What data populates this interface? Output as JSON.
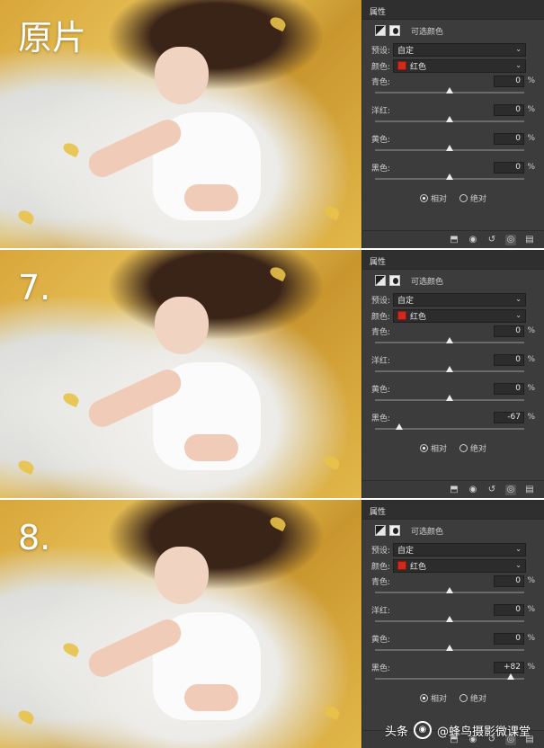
{
  "panels": [
    {
      "label": "原片",
      "title": "属性",
      "layer_name": "可选颜色",
      "preset_label": "预设:",
      "preset_value": "自定",
      "color_label": "颜色:",
      "color_value": "红色",
      "sliders": [
        {
          "name": "青色:",
          "value": "0",
          "unit": "%",
          "level": 0
        },
        {
          "name": "洋红:",
          "value": "0",
          "unit": "%",
          "level": 0
        },
        {
          "name": "黄色:",
          "value": "0",
          "unit": "%",
          "level": 0
        },
        {
          "name": "黑色:",
          "value": "0",
          "unit": "%",
          "level": 0
        }
      ],
      "relative_label": "相对",
      "absolute_label": "绝对"
    },
    {
      "label": "7.",
      "title": "属性",
      "layer_name": "可选颜色",
      "preset_label": "预设:",
      "preset_value": "自定",
      "color_label": "颜色:",
      "color_value": "红色",
      "sliders": [
        {
          "name": "青色:",
          "value": "0",
          "unit": "%",
          "level": 0
        },
        {
          "name": "洋红:",
          "value": "0",
          "unit": "%",
          "level": 0
        },
        {
          "name": "黄色:",
          "value": "0",
          "unit": "%",
          "level": 0
        },
        {
          "name": "黑色:",
          "value": "-67",
          "unit": "%",
          "level": -67
        }
      ],
      "relative_label": "相对",
      "absolute_label": "绝对"
    },
    {
      "label": "8.",
      "title": "属性",
      "layer_name": "可选颜色",
      "preset_label": "预设:",
      "preset_value": "自定",
      "color_label": "颜色:",
      "color_value": "红色",
      "sliders": [
        {
          "name": "青色:",
          "value": "0",
          "unit": "%",
          "level": 0
        },
        {
          "name": "洋红:",
          "value": "0",
          "unit": "%",
          "level": 0
        },
        {
          "name": "黄色:",
          "value": "0",
          "unit": "%",
          "level": 0
        },
        {
          "name": "黑色:",
          "value": "+82",
          "unit": "%",
          "level": 82
        }
      ],
      "relative_label": "相对",
      "absolute_label": "绝对"
    }
  ],
  "toolbar_icons": [
    "clip-to-layer-icon",
    "view-previous-icon",
    "reset-icon",
    "visibility-eye-icon",
    "trash-icon"
  ],
  "watermark": {
    "prefix": "头条",
    "text": "@蜂鸟摄影微课堂"
  },
  "colors": {
    "panel_bg": "#3c3c3c",
    "red_swatch": "#d12a1a"
  }
}
